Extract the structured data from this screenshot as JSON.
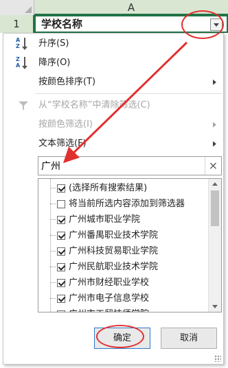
{
  "sheet": {
    "column_label": "A",
    "row_label": "1",
    "cell_value": "学校名称"
  },
  "menu": {
    "sort_asc": "升序(S)",
    "sort_desc": "降序(O)",
    "sort_by_color": "按颜色排序(T)",
    "clear_filter": "从“学校名称”中清除筛选(C)",
    "filter_by_color": "按颜色筛选(I)",
    "text_filter": "文本筛选(F)"
  },
  "search": {
    "value": "广州"
  },
  "list": [
    {
      "label": "(选择所有搜索结果)",
      "checked": true
    },
    {
      "label": "将当前所选内容添加到筛选器",
      "checked": false
    },
    {
      "label": "广州城市职业学院",
      "checked": true
    },
    {
      "label": "广州番禺职业技术学院",
      "checked": true
    },
    {
      "label": "广州科技贸易职业学院",
      "checked": true
    },
    {
      "label": "广州民航职业技术学院",
      "checked": true
    },
    {
      "label": "广州市财经职业学校",
      "checked": true
    },
    {
      "label": "广州市电子信息学校",
      "checked": true
    },
    {
      "label": "广州市工贸技师学院",
      "checked": true
    }
  ],
  "buttons": {
    "ok": "确定",
    "cancel": "取消"
  },
  "annotation_color": "#e0302e"
}
